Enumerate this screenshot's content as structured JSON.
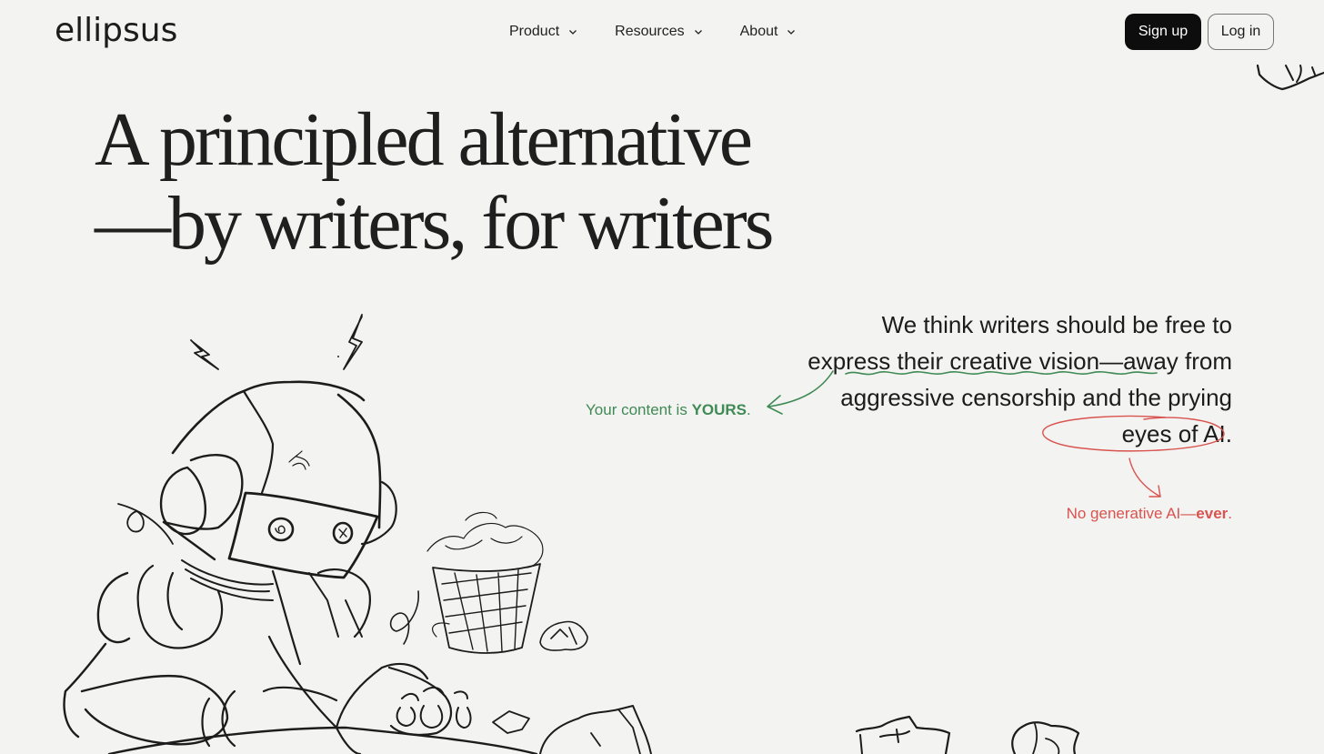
{
  "header": {
    "logo": "ellipsus",
    "nav": [
      {
        "label": "Product",
        "icon": "chevron-down-icon"
      },
      {
        "label": "Resources",
        "icon": "chevron-down-icon"
      },
      {
        "label": "About",
        "icon": "chevron-down-icon"
      }
    ],
    "signup_label": "Sign up",
    "login_label": "Log in"
  },
  "hero": {
    "title_line1": "A principled alternative",
    "title_line2": "—by writers, for writers"
  },
  "statement": {
    "part1": "We think writers should be free to ",
    "underlined": "express their creative vision",
    "part2": "—away from aggressive censorship and the ",
    "circled": "prying eyes of AI",
    "part3": "."
  },
  "annotations": {
    "green_prefix": "Your content is ",
    "green_bold": "YOURS",
    "green_suffix": ".",
    "red_prefix": "No generative AI—",
    "red_bold": "ever",
    "red_suffix": "."
  },
  "colors": {
    "background": "#f3f3f1",
    "accent_green": "#3f8a55",
    "accent_red": "#d9534f",
    "button_dark": "#0d0d0d"
  },
  "illustration": {
    "subject": "robot-writer-sketch",
    "elements": [
      "robot-character",
      "lightning-bolts",
      "paper-basket",
      "crumpled-papers"
    ]
  }
}
